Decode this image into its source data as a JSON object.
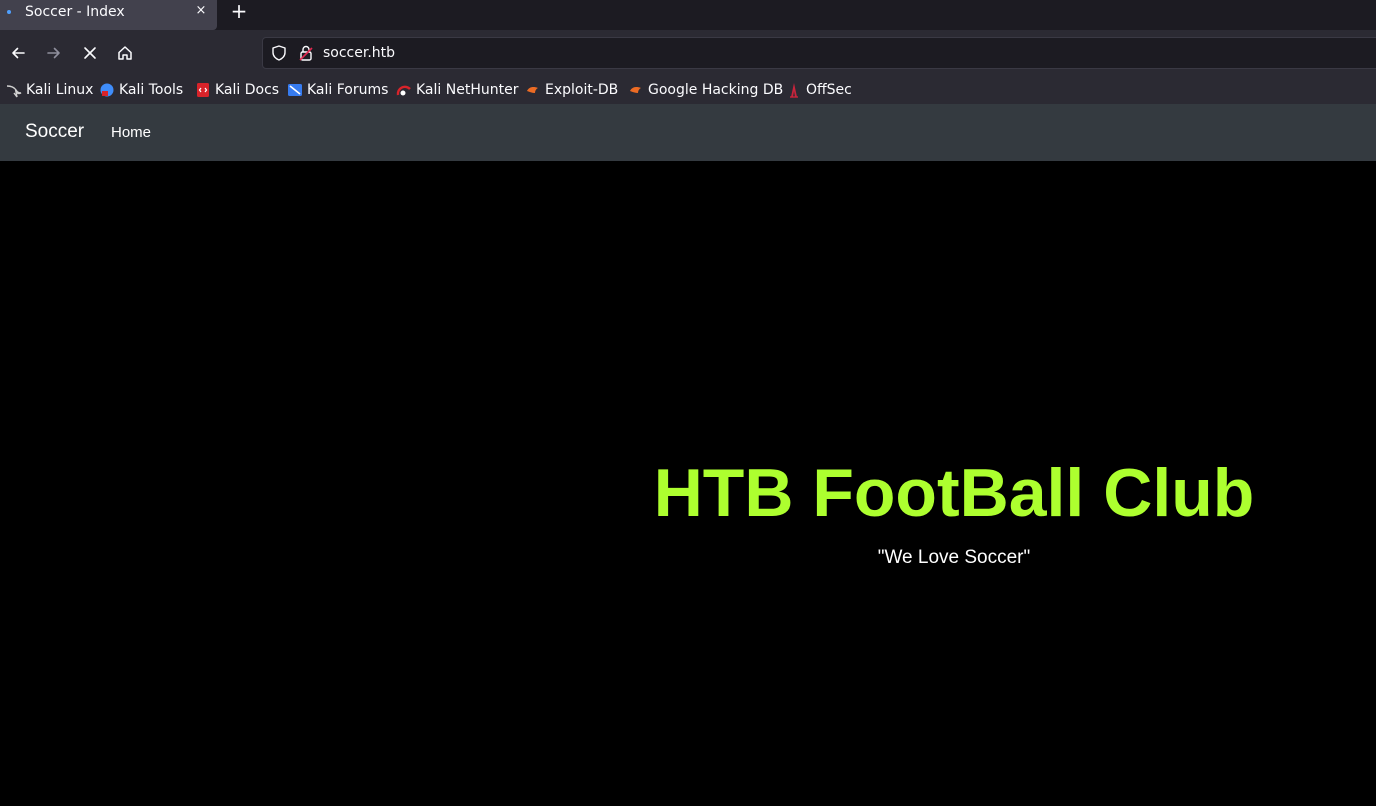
{
  "browser": {
    "tab": {
      "title": "Soccer - Index",
      "close_glyph": "×"
    },
    "new_tab_glyph": "+",
    "nav": {
      "back_icon": "arrow-left-icon",
      "forward_icon": "arrow-right-icon",
      "stop_icon": "close-icon",
      "home_icon": "home-icon"
    },
    "url": "soccer.htb",
    "bookmarks": [
      {
        "label": "Kali Linux",
        "icon": "kali-dragon-icon",
        "color": "#d0d0d0"
      },
      {
        "label": "Kali Tools",
        "icon": "kali-tools-icon",
        "color": "#3f8dfb"
      },
      {
        "label": "Kali Docs",
        "icon": "kali-docs-icon",
        "color": "#d8232a"
      },
      {
        "label": "Kali Forums",
        "icon": "kali-forums-icon",
        "color": "#367bf0"
      },
      {
        "label": "Kali NetHunter",
        "icon": "nethunter-icon",
        "color": "#d8232a"
      },
      {
        "label": "Exploit-DB",
        "icon": "exploit-db-icon",
        "color": "#ec6b24"
      },
      {
        "label": "Google Hacking DB",
        "icon": "ghdb-icon",
        "color": "#ec6b24"
      },
      {
        "label": "OffSec",
        "icon": "offsec-icon",
        "color": "#c9243c"
      }
    ]
  },
  "site": {
    "brand": "Soccer",
    "nav_home": "Home",
    "hero_title": "HTB FootBall Club",
    "hero_subtitle": "\"We Love Soccer\""
  },
  "colors": {
    "accent_title": "#adff2f",
    "site_nav_bg": "#343a40",
    "browser_chrome": "#2b2a33"
  }
}
